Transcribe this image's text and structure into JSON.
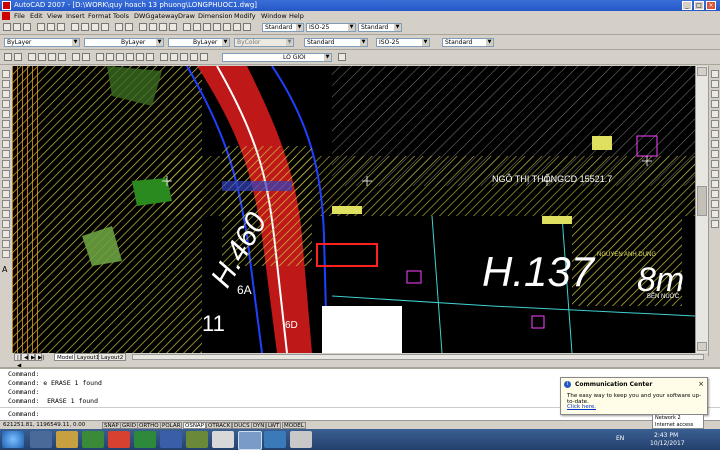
{
  "app": {
    "title": "AutoCAD 2007 - [D:\\WORK\\quy hoach 13 phuong\\LONGPHUOC1.dwg]",
    "window_controls": [
      "_",
      "□",
      "×"
    ]
  },
  "menu": [
    "File",
    "Edit",
    "View",
    "Insert",
    "Format",
    "Tools",
    "DWGgateway",
    "Draw",
    "Dimension",
    "Modify",
    "Window",
    "Help"
  ],
  "toolbar": {
    "text_style": "ISO-25",
    "dim_style": "ISO-25",
    "table_style": "Standard",
    "layer_current": "LO GIOI",
    "color": "ByLayer",
    "linetype": "ByLayer",
    "lineweight": "ByLayer",
    "plot_style": "ByColor",
    "dim_style_2": "Standard",
    "dim_iso": "ISO-25",
    "standard_3": "Standard"
  },
  "drawing": {
    "labels": {
      "lot_137": "H.137",
      "lot_460": "H.460",
      "ngo_thi": "NGÔ THỊ THỐNGCD 15521.7",
      "eight_m": "8m",
      "six_a": "6A",
      "eleven": "11",
      "six_d": "6D",
      "nguyen_anh_dung": "NGUYEN ANH DUNG",
      "lot_text_1": "BỂN NUỚC"
    }
  },
  "tabs": [
    "Model",
    "Layout1",
    "Layout2"
  ],
  "command": {
    "lines": [
      "Command:",
      "Command: e ERASE 1 found",
      "Command:",
      "Command:  ERASE 1 found",
      "",
      "Command:"
    ]
  },
  "popup": {
    "title": "Communication Center",
    "body": "The easy way to keep you and your software up-to-date.",
    "link": "Click here."
  },
  "status": {
    "coords": "621251.81, 1196549.11, 0.00",
    "toggles": [
      "SNAP",
      "GRID",
      "ORTHO",
      "POLAR",
      "OSNAP",
      "OTRACK",
      "DUCS",
      "DYN",
      "LWT",
      "MODEL"
    ],
    "network_title": "Network 2",
    "network_sub": "Internet access"
  },
  "taskbar": {
    "lang": "EN",
    "time": "2:43 PM",
    "date": "10/12/2017"
  },
  "colors": {
    "title_blue": "#2458c8",
    "drawing_bg": "#000000",
    "hatch_yellow": "#d8d850",
    "road_red": "#ff2020",
    "road_blue": "#2040ff",
    "popup_bg": "#fffde8"
  }
}
